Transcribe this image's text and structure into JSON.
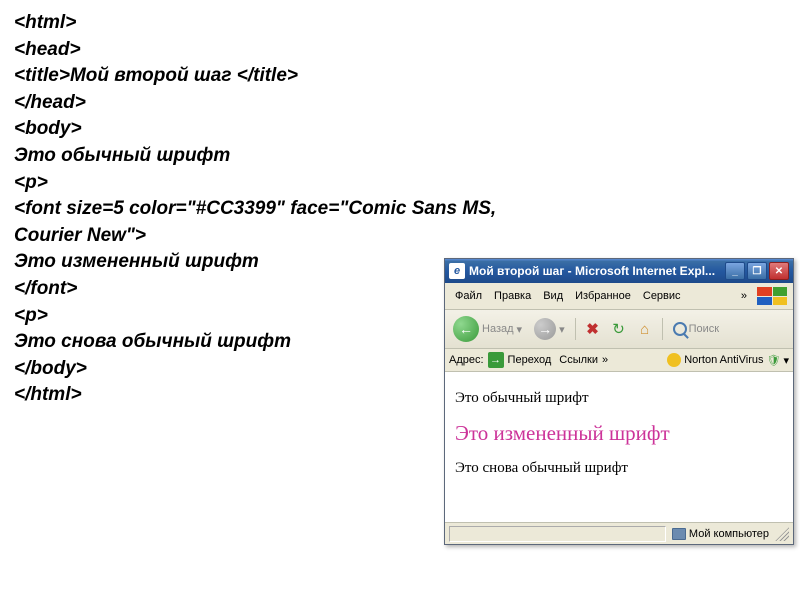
{
  "code": {
    "l1": "<html>",
    "l2": "<head>",
    "l3": "<title>Мой второй шаг </title>",
    "l4": "</head>",
    "l5": "<body>",
    "l6": "Это обычный шрифт",
    "l7": "<p>",
    "l8": "<font size=5 color=\"#CC3399\" face=\"Comic Sans MS,",
    "l9": "Courier New\">",
    "l10": "Это измененный шрифт",
    "l11": "</font>",
    "l12": "<p>",
    "l13": "Это снова обычный шрифт",
    "l14": "</body>",
    "l15": "</html>"
  },
  "ie": {
    "title": "Мой второй шаг - Microsoft Internet Expl...",
    "menu": {
      "file": "Файл",
      "edit": "Правка",
      "view": "Вид",
      "favorites": "Избранное",
      "tools": "Сервис"
    },
    "toolbar": {
      "back": "Назад",
      "search": "Поиск"
    },
    "addrbar": {
      "label": "Адрес:",
      "go": "Переход",
      "links": "Ссылки",
      "norton": "Norton AntiVirus"
    },
    "content": {
      "line1": "Это обычный шрифт",
      "line2": "Это измененный шрифт",
      "line3": "Это снова обычный шрифт"
    },
    "status": {
      "computer": "Мой компьютер"
    }
  }
}
